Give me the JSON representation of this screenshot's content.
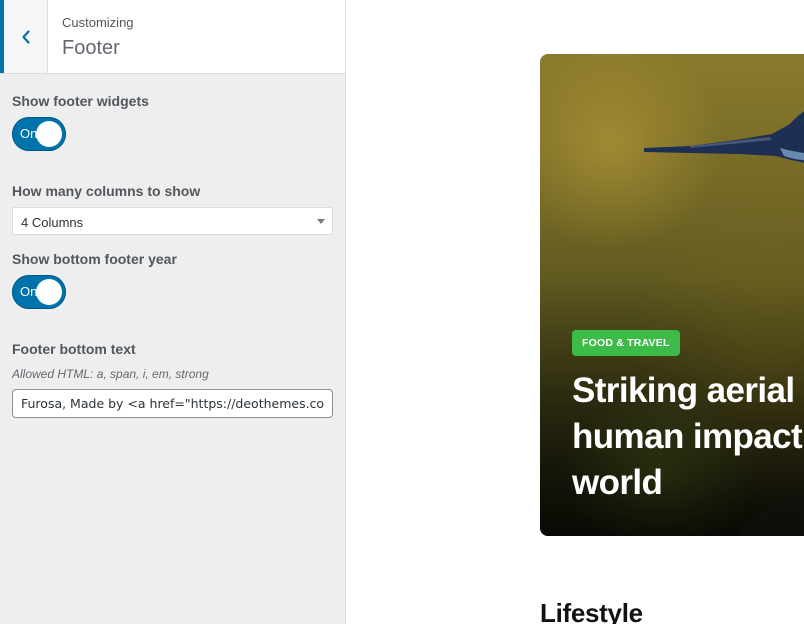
{
  "header": {
    "breadcrumb": "Customizing",
    "section_title": "Footer"
  },
  "controls": {
    "show_footer_widgets": {
      "label": "Show footer widgets",
      "toggle_text": "On"
    },
    "columns": {
      "label": "How many columns to show",
      "selected": "4 Columns"
    },
    "show_bottom_year": {
      "label": "Show bottom footer year",
      "toggle_text": "On"
    },
    "bottom_text": {
      "label": "Footer bottom text",
      "description": "Allowed HTML: a, span, i, em, strong",
      "value": "Furosa, Made by <a href=\"https://deothemes.com\">DeoThemes</a>"
    }
  },
  "preview": {
    "badge": "FOOD & TRAVEL",
    "title_lines": [
      "Striking aerial p",
      "human impact c",
      "world"
    ],
    "section_heading": "Lifestyle"
  },
  "colors": {
    "accent": "#0073aa",
    "badge": "#3dbb48",
    "sidebar_bg": "#eeeeee"
  },
  "icons": {
    "back": "chevron-left-icon",
    "select": "caret-down-icon"
  }
}
